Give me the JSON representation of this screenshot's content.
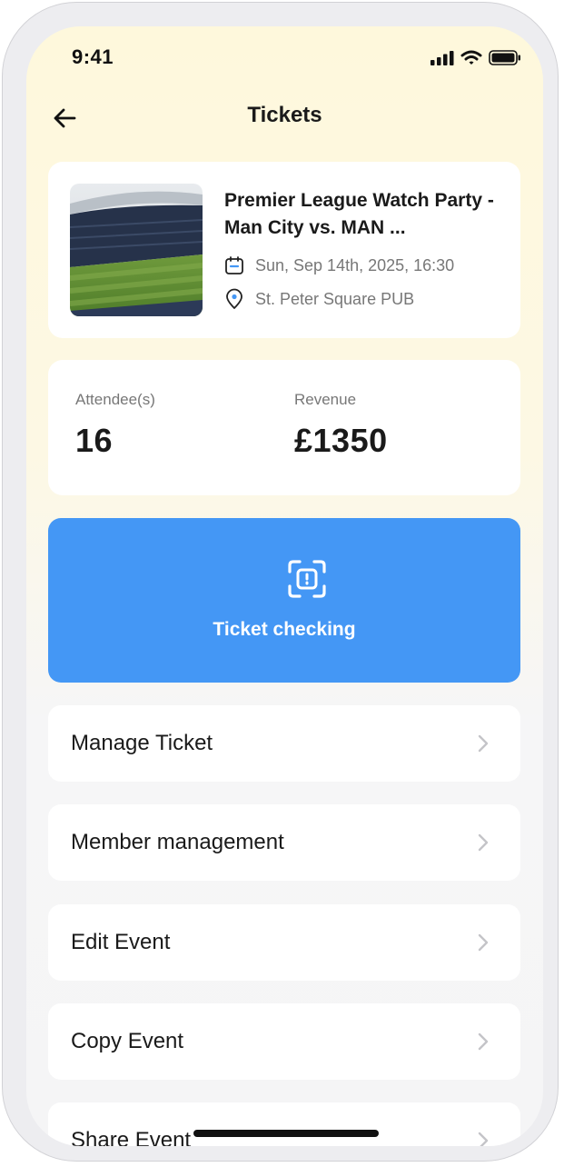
{
  "status_bar": {
    "time": "9:41"
  },
  "header": {
    "title": "Tickets"
  },
  "event": {
    "title": "Premier League Watch Party - Man City vs. MAN ...",
    "date": "Sun, Sep 14th, 2025, 16:30",
    "location": "St. Peter Square PUB"
  },
  "stats": {
    "attendees_label": "Attendee(s)",
    "attendees_value": "16",
    "revenue_label": "Revenue",
    "revenue_value": "£1350"
  },
  "ticket_checking": {
    "label": "Ticket checking",
    "icon": "scan-icon"
  },
  "menu": [
    {
      "label": "Manage Ticket"
    },
    {
      "label": "Member management"
    },
    {
      "label": "Edit Event"
    },
    {
      "label": "Copy Event"
    },
    {
      "label": "Share Event"
    }
  ],
  "colors": {
    "accent": "#4497f5",
    "calendar_accent": "#4497f5"
  }
}
